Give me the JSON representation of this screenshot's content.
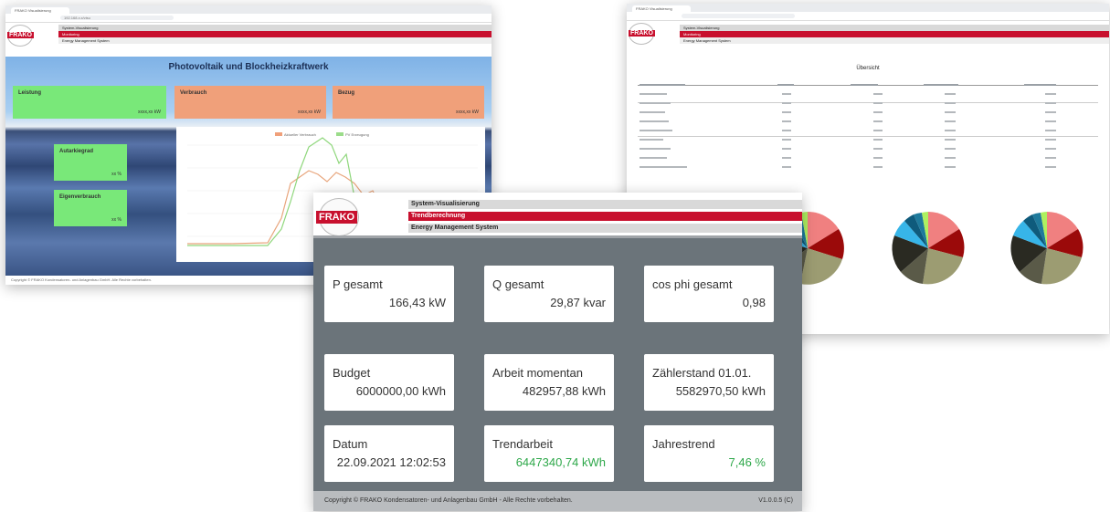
{
  "winA": {
    "tab": "FRAKO Visualisierung",
    "url": "192.168.x.x/visu",
    "header": {
      "line1": "System-Visualisierung",
      "line2": "Monitoring",
      "line3": "Energy Management System"
    },
    "title": "Photovoltaik und Blockheizkraftwerk",
    "tiles": [
      {
        "label": "Leistung",
        "value": "xxxx,xx kW"
      },
      {
        "label": "Verbrauch",
        "value": "xxxx,xx kW"
      },
      {
        "label": "Bezug",
        "value": "xxxx,xx kW"
      },
      {
        "label": "Autarkiegrad",
        "value": "xx %"
      },
      {
        "label": "Eigenverbrauch",
        "value": "xx %"
      }
    ],
    "chart_legend": [
      "Aktueller Verbrauch",
      "PV Erzeugung"
    ],
    "footer": "Copyright © FRAKO Kondensatoren- und Anlagenbau GmbH. Alle Rechte vorbehalten."
  },
  "winB": {
    "tab": "FRAKO Visualisierung",
    "header": {
      "line1": "System-Visualisierung",
      "line2": "Monitoring",
      "line3": "Energy Management System"
    },
    "table_title": "Übersicht"
  },
  "winC": {
    "header": {
      "line1": "System-Visualisierung",
      "line2": "Trendberechnung",
      "line3": "Energy Management System"
    },
    "cards": [
      {
        "label": "P gesamt",
        "value": "166,43 kW"
      },
      {
        "label": "Q gesamt",
        "value": "29,87 kvar"
      },
      {
        "label": "cos phi gesamt",
        "value": "0,98"
      },
      {
        "label": "Budget",
        "value": "6000000,00 kWh"
      },
      {
        "label": "Arbeit momentan",
        "value": "482957,88 kWh"
      },
      {
        "label": "Zählerstand 01.01.",
        "value": "5582970,50 kWh"
      },
      {
        "label": "Datum",
        "value": "22.09.2021 12:02:53"
      },
      {
        "label": "Trendarbeit",
        "value": "6447340,74 kWh"
      },
      {
        "label": "Jahrestrend",
        "value": "7,46 %"
      }
    ],
    "footer": "Copyright © FRAKO Kondensatoren- und Anlagenbau GmbH - Alle Rechte vorbehalten.",
    "version": "V1.0.0.5 (C)"
  },
  "colors": {
    "brand_red": "#c8102e",
    "tile_green": "#79e879",
    "tile_orange": "#f0a07a",
    "trend_green": "#2ea84a"
  }
}
